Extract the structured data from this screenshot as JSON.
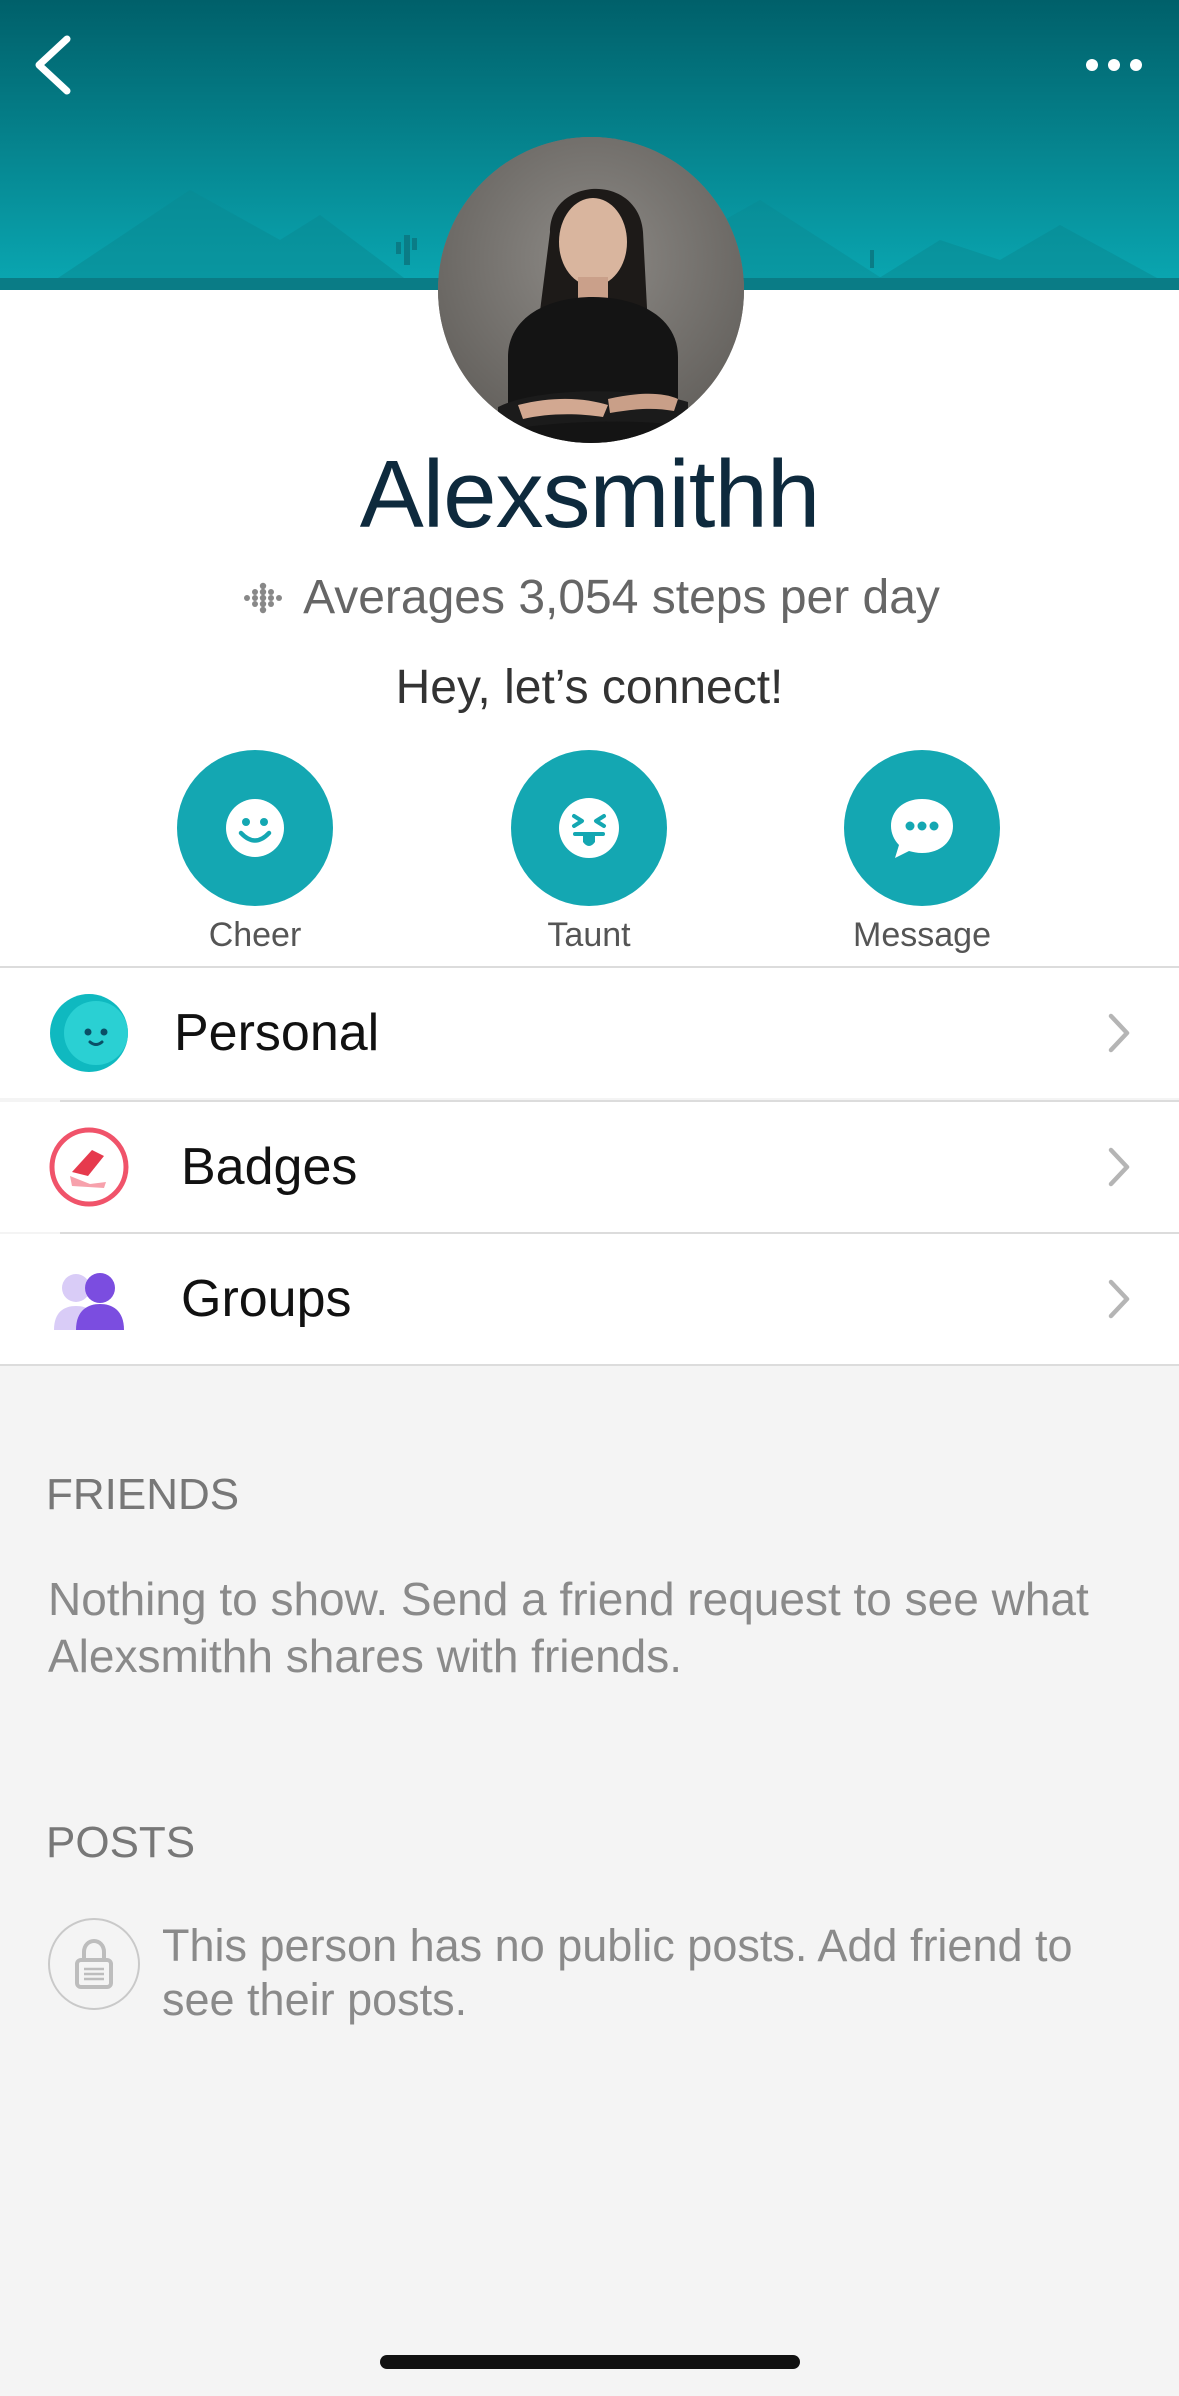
{
  "header": {
    "back_icon": "chevron-left-icon",
    "more_icon": "ellipsis-icon",
    "colors": {
      "top": "#00606a",
      "bottom": "#0aa8b3"
    }
  },
  "profile": {
    "name": "Alexsmithh",
    "averages_text": "Averages 3,054 steps per day",
    "bio": "Hey, let’s connect!"
  },
  "actions": [
    {
      "label": "Cheer",
      "icon": "smile-face-icon"
    },
    {
      "label": "Taunt",
      "icon": "tongue-face-icon"
    },
    {
      "label": "Message",
      "icon": "chat-bubble-icon"
    }
  ],
  "menu": [
    {
      "label": "Personal",
      "icon": "personal-face-icon"
    },
    {
      "label": "Badges",
      "icon": "badge-shoe-icon"
    },
    {
      "label": "Groups",
      "icon": "groups-people-icon"
    }
  ],
  "friends": {
    "title": "FRIENDS",
    "text": "Nothing to show. Send a friend request to see what Alexsmithh shares with friends."
  },
  "posts": {
    "title": "POSTS",
    "text": "This person has no public posts. Add friend to see their posts.",
    "icon": "lock-icon"
  },
  "accent_color": "#14a7b2"
}
